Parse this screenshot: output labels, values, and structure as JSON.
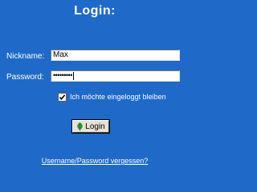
{
  "title": "Login:",
  "nickname": {
    "label": "Nickname:",
    "value": "Max"
  },
  "password": {
    "label": "Password:",
    "masked_value": "•••••••••"
  },
  "remember": {
    "label": "Ich möchte eingeloggt bleiben",
    "checked": true
  },
  "login_button": {
    "label": "Login",
    "icon": "leaf-icon"
  },
  "forgot_link": "Username/Password vergessen?",
  "colors": {
    "background": "#1f6ac8",
    "text": "#ffffff",
    "button_face": "#e6e2d6",
    "leaf_icon": "#2f9e2f"
  }
}
